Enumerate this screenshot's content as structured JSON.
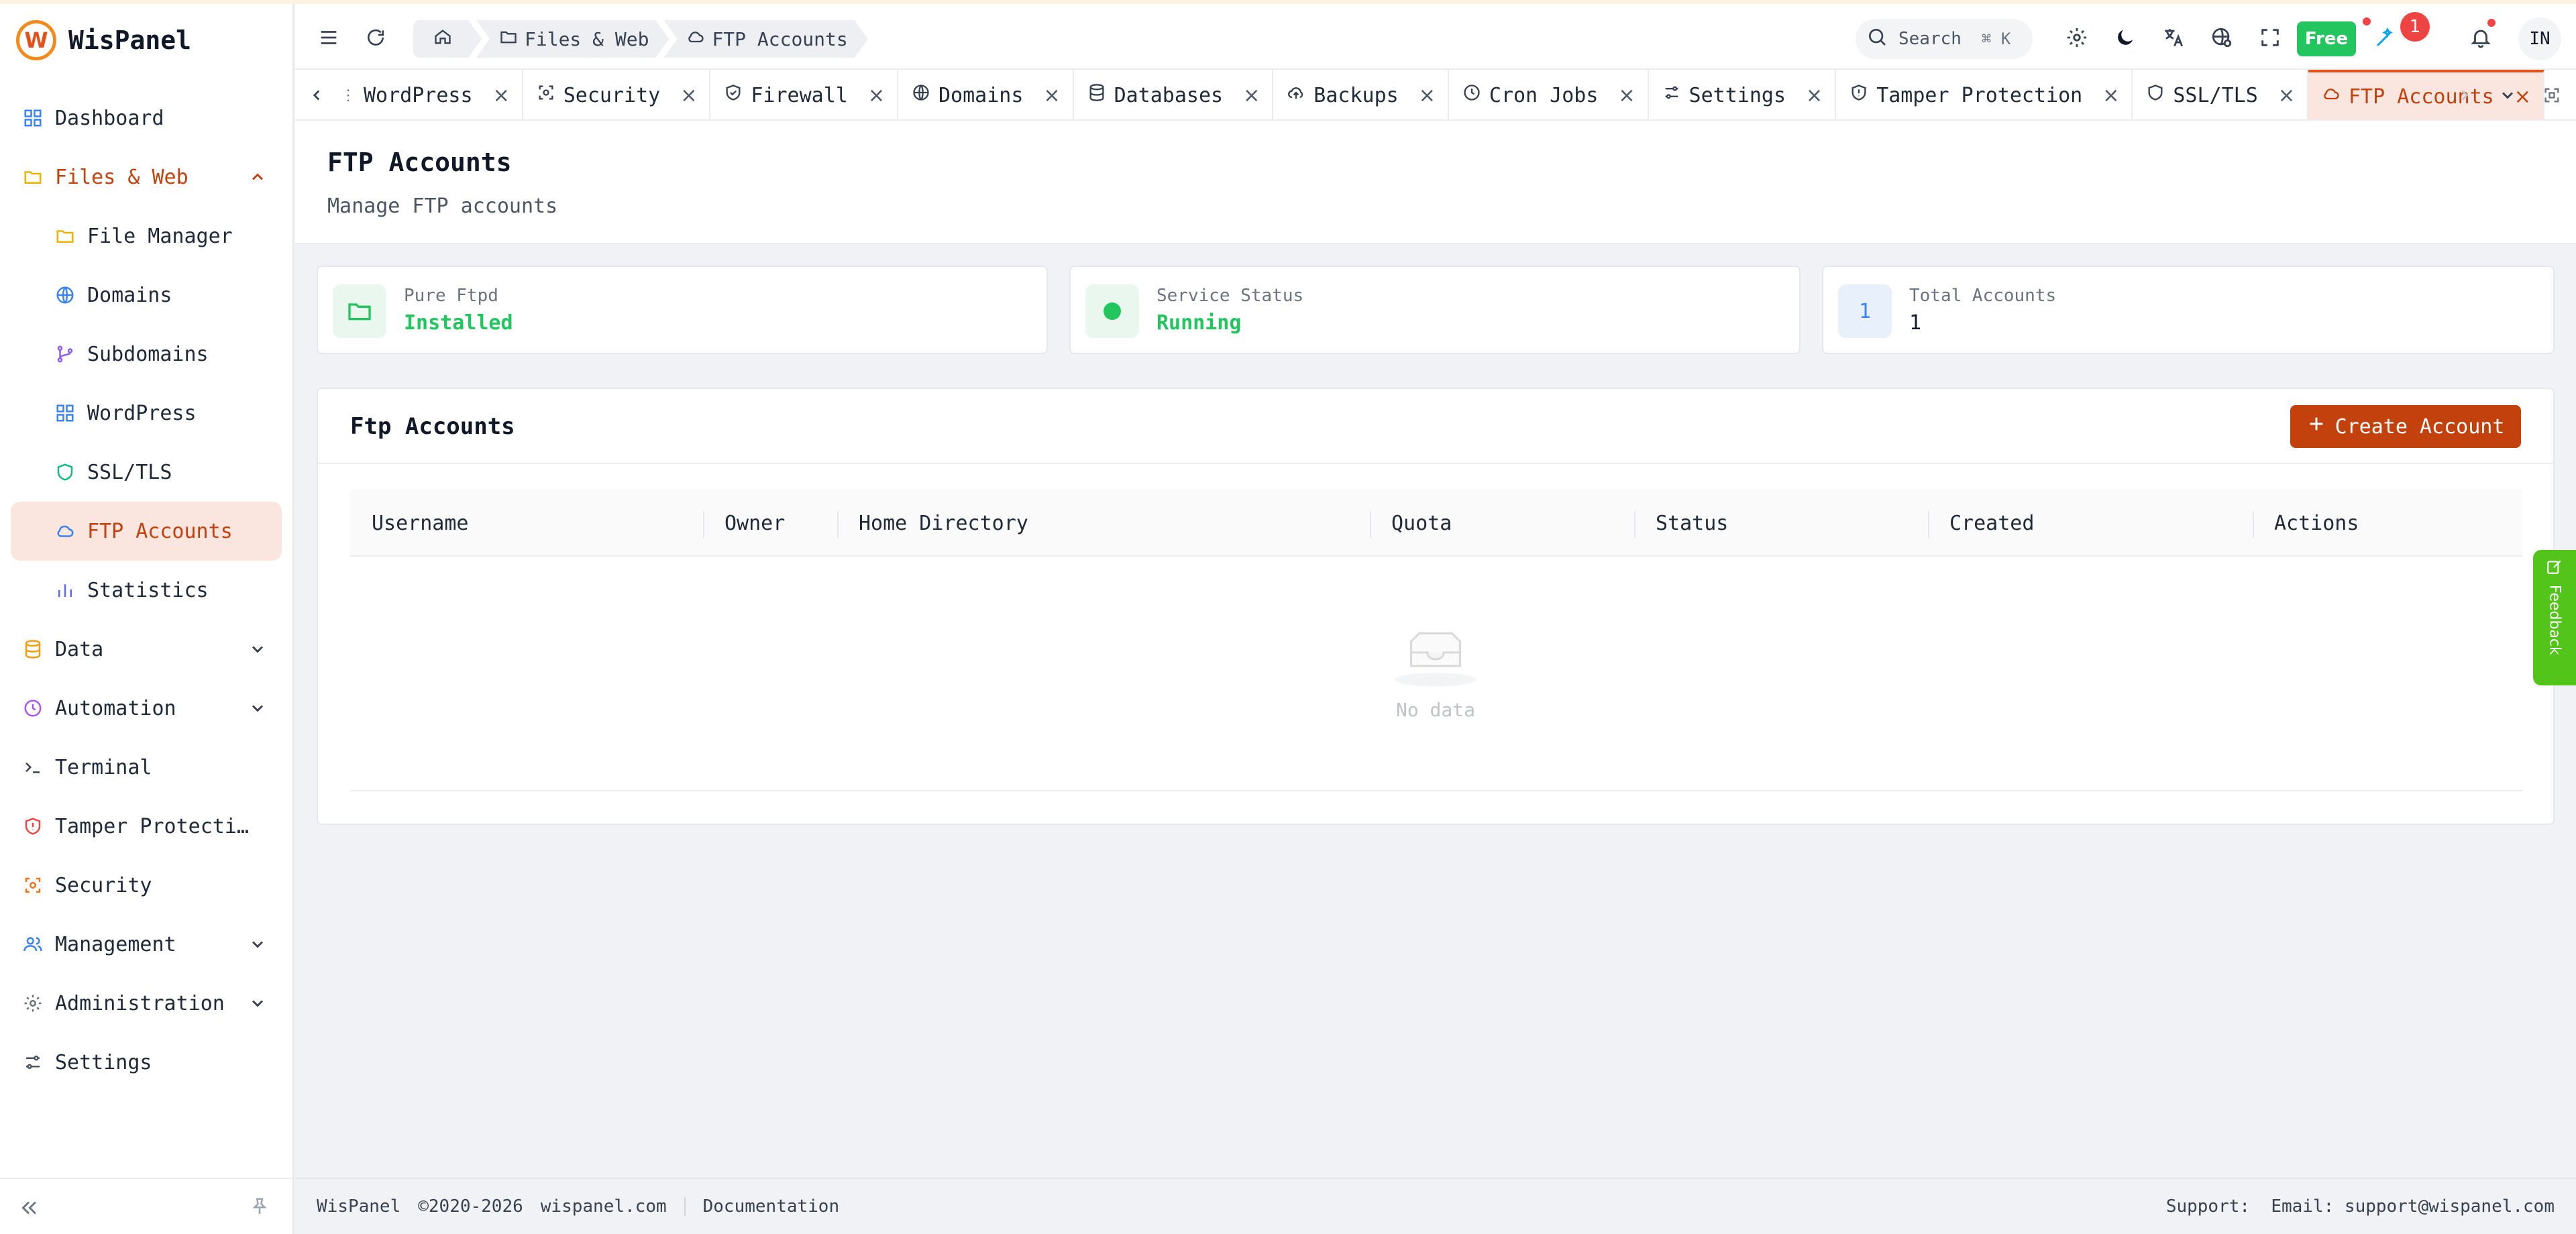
{
  "app": {
    "name": "WisPanel",
    "logo_letter": "W"
  },
  "sidebar": {
    "items": [
      {
        "label": "Dashboard",
        "icon": "grid-icon"
      },
      {
        "label": "Files & Web",
        "icon": "folder-icon",
        "expanded": true
      },
      {
        "label": "File Manager",
        "icon": "folder-icon"
      },
      {
        "label": "Domains",
        "icon": "globe-icon"
      },
      {
        "label": "Subdomains",
        "icon": "branch-icon"
      },
      {
        "label": "WordPress",
        "icon": "grid-icon"
      },
      {
        "label": "SSL/TLS",
        "icon": "shield-icon"
      },
      {
        "label": "FTP Accounts",
        "icon": "cloud-icon",
        "active": true
      },
      {
        "label": "Statistics",
        "icon": "bar-chart-icon"
      },
      {
        "label": "Data",
        "icon": "database-icon"
      },
      {
        "label": "Automation",
        "icon": "clock-icon"
      },
      {
        "label": "Terminal",
        "icon": "terminal-icon"
      },
      {
        "label": "Tamper Protecti…",
        "icon": "shield-alert-icon"
      },
      {
        "label": "Security",
        "icon": "scan-icon"
      },
      {
        "label": "Management",
        "icon": "users-icon"
      },
      {
        "label": "Administration",
        "icon": "gear-icon"
      },
      {
        "label": "Settings",
        "icon": "sliders-icon"
      }
    ]
  },
  "header": {
    "breadcrumbs": [
      "Files & Web",
      "FTP Accounts"
    ],
    "search_label": "Search",
    "search_shortcut": "⌘ K",
    "plan_label": "Free",
    "notification_count": "1",
    "avatar_initials": "IN"
  },
  "tabs": [
    {
      "label": "WordPress",
      "icon": "grid-icon"
    },
    {
      "label": "Security",
      "icon": "scan-icon"
    },
    {
      "label": "Firewall",
      "icon": "shield-check-icon"
    },
    {
      "label": "Domains",
      "icon": "globe-icon"
    },
    {
      "label": "Databases",
      "icon": "database-icon"
    },
    {
      "label": "Backups",
      "icon": "cloud-upload-icon"
    },
    {
      "label": "Cron Jobs",
      "icon": "clock-icon"
    },
    {
      "label": "Settings",
      "icon": "sliders-icon"
    },
    {
      "label": "Tamper Protection",
      "icon": "shield-alert-icon"
    },
    {
      "label": "SSL/TLS",
      "icon": "shield-icon"
    },
    {
      "label": "FTP Accounts",
      "icon": "cloud-icon",
      "active": true
    }
  ],
  "page": {
    "title": "FTP Accounts",
    "subtitle": "Manage FTP accounts"
  },
  "stats": [
    {
      "label": "Pure Ftpd",
      "value": "Installed"
    },
    {
      "label": "Service Status",
      "value": "Running"
    },
    {
      "label": "Total Accounts",
      "value": "1",
      "icon_text": "1"
    }
  ],
  "panel": {
    "title": "Ftp Accounts",
    "create_label": "Create Account",
    "columns": [
      "Username",
      "Owner",
      "Home Directory",
      "Quota",
      "Status",
      "Created",
      "Actions"
    ],
    "empty_text": "No data"
  },
  "feedback_label": "Feedback",
  "footer": {
    "brand": "WisPanel",
    "copyright": "©2020-2026",
    "site": "wispanel.com",
    "docs": "Documentation",
    "support": "Support:  Email: support@wispanel.com"
  },
  "colors": {
    "accent": "#c2410c",
    "success": "#22c55e",
    "feedback": "#52c41a"
  }
}
